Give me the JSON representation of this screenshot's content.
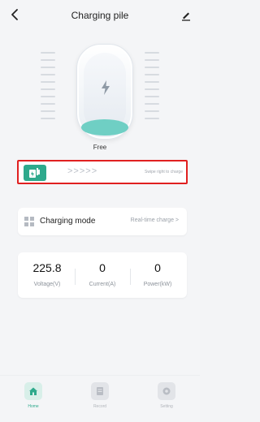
{
  "header": {
    "title": "Charging pile",
    "back_icon": "chevron-left-icon",
    "edit_icon": "pencil-icon"
  },
  "pile": {
    "status": "Free",
    "accent_color": "#6fcfc4"
  },
  "swipe": {
    "chevrons": ">>>>>",
    "hint": "Swipe right to charge",
    "knob_color": "#2ea98c",
    "border_color": "#e02020"
  },
  "mode": {
    "label": "Charging mode",
    "value": "Real-time charge >"
  },
  "stats": [
    {
      "value": "225.8",
      "label": "Voltage(V)"
    },
    {
      "value": "0",
      "label": "Current(A)"
    },
    {
      "value": "0",
      "label": "Power(kW)"
    }
  ],
  "nav": [
    {
      "label": "Home",
      "icon": "home-icon",
      "active": true
    },
    {
      "label": "Record",
      "icon": "record-icon",
      "active": false
    },
    {
      "label": "Setting",
      "icon": "setting-icon",
      "active": false
    }
  ]
}
